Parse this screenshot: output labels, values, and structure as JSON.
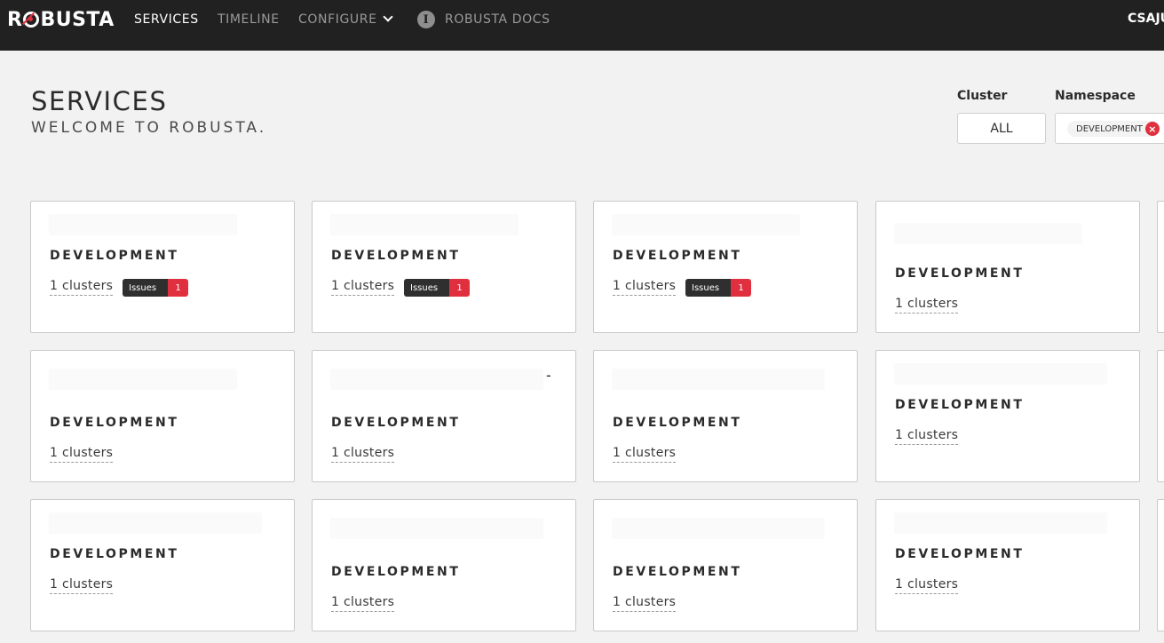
{
  "brand": {
    "logo_text_pre": "R",
    "logo_text_post": "BUSTA"
  },
  "nav": {
    "services": "SERVICES",
    "timeline": "TIMELINE",
    "configure": "CONFIGURE",
    "docs": "ROBUSTA DOCS"
  },
  "user": {
    "name": "CSAJU"
  },
  "page": {
    "title": "SERVICES",
    "subtitle": "WELCOME TO ROBUSTA."
  },
  "filters": {
    "cluster_label": "Cluster",
    "cluster_value": "ALL",
    "namespace_label": "Namespace",
    "namespace_chip": "DEVELOPMENT"
  },
  "cards": [
    {
      "namespace": "DEVELOPMENT",
      "clusters": "1 clusters",
      "issues_label": "Issues",
      "issues_count": "1"
    },
    {
      "namespace": "DEVELOPMENT",
      "clusters": "1 clusters",
      "issues_label": "Issues",
      "issues_count": "1"
    },
    {
      "namespace": "DEVELOPMENT",
      "clusters": "1 clusters",
      "issues_label": "Issues",
      "issues_count": "1"
    },
    {
      "namespace": "DEVELOPMENT",
      "clusters": "1 clusters"
    },
    {
      "namespace": "DEVELOPMENT",
      "clusters": "1 clusters"
    },
    {
      "namespace": "DEVELOPMENT",
      "clusters": "1 clusters",
      "mark": "-"
    },
    {
      "namespace": "DEVELOPMENT",
      "clusters": "1 clusters"
    },
    {
      "namespace": "DEVELOPMENT",
      "clusters": "1 clusters"
    },
    {
      "namespace": "DEVELOPMENT",
      "clusters": "1 clusters"
    },
    {
      "namespace": "DEVELOPMENT",
      "clusters": "1 clusters"
    },
    {
      "namespace": "DEVELOPMENT",
      "clusters": "1 clusters"
    },
    {
      "namespace": "DEVELOPMENT",
      "clusters": "1 clusters"
    }
  ],
  "colors": {
    "topbar": "#212121",
    "accent": "#e0303f",
    "background": "#f2f2f2"
  }
}
